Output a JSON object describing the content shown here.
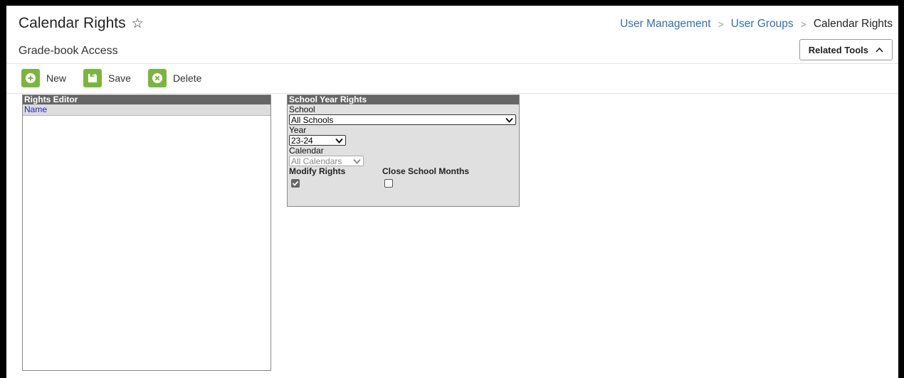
{
  "header": {
    "title": "Calendar Rights",
    "subtitle": "Grade-book Access",
    "related_tools_label": "Related Tools"
  },
  "breadcrumb": {
    "items": [
      "User Management",
      "User Groups"
    ],
    "current": "Calendar Rights",
    "separator": ">"
  },
  "toolbar": {
    "new_label": "New",
    "save_label": "Save",
    "delete_label": "Delete"
  },
  "rights_editor": {
    "title": "Rights Editor",
    "column_name": "Name"
  },
  "school_year_rights": {
    "title": "School Year Rights",
    "school_label": "School",
    "school_value": "All Schools",
    "year_label": "Year",
    "year_value": "23-24",
    "calendar_label": "Calendar",
    "calendar_value": "All Calendars",
    "modify_rights_label": "Modify Rights",
    "modify_rights_checked": true,
    "close_months_label": "Close School Months",
    "close_months_checked": false
  },
  "colors": {
    "accent_green": "#7bb63c",
    "link_blue": "#2f6fb1",
    "panel_header": "#666666"
  }
}
